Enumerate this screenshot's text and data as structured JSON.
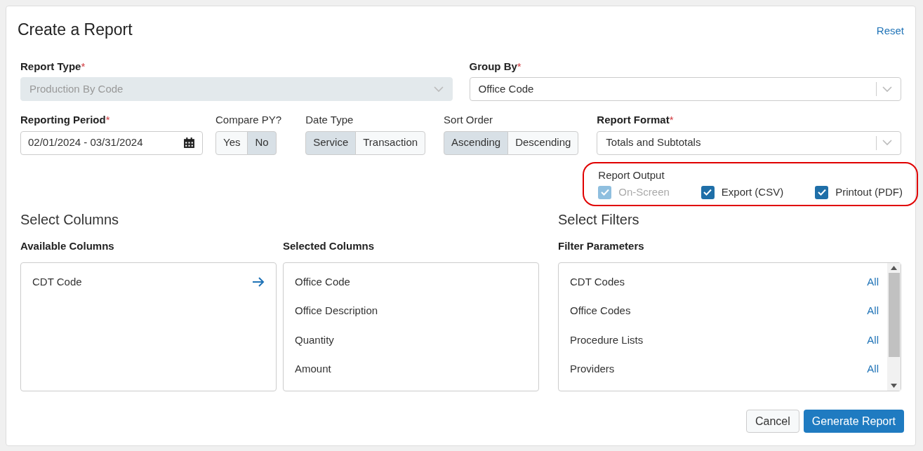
{
  "dialog": {
    "title": "Create a Report",
    "reset_link": "Reset"
  },
  "report_type": {
    "label": "Report Type",
    "required": "*",
    "value": "Production By Code",
    "disabled": true
  },
  "group_by": {
    "label": "Group By",
    "required": "*",
    "value": "Office Code",
    "disabled": false
  },
  "reporting_period": {
    "label": "Reporting Period",
    "required": "*",
    "value": "02/01/2024 - 03/31/2024"
  },
  "compare_py": {
    "label": "Compare PY?",
    "options": [
      {
        "label": "Yes",
        "selected": false
      },
      {
        "label": "No",
        "selected": true
      }
    ]
  },
  "date_type": {
    "label": "Date Type",
    "options": [
      {
        "label": "Service",
        "selected": true
      },
      {
        "label": "Transaction",
        "selected": false
      }
    ]
  },
  "sort_order": {
    "label": "Sort Order",
    "options": [
      {
        "label": "Ascending",
        "selected": true
      },
      {
        "label": "Descending",
        "selected": false
      }
    ]
  },
  "report_format": {
    "label": "Report Format",
    "required": "*",
    "value": "Totals and Subtotals",
    "disabled": false
  },
  "report_output": {
    "label": "Report Output",
    "highlighted": true,
    "options": [
      {
        "label": "On-Screen",
        "checked": true,
        "disabled": true
      },
      {
        "label": "Export (CSV)",
        "checked": true,
        "disabled": false
      },
      {
        "label": "Printout (PDF)",
        "checked": true,
        "disabled": false
      }
    ]
  },
  "select_columns": {
    "title": "Select Columns",
    "available": {
      "label": "Available Columns",
      "items": [
        "CDT Code"
      ]
    },
    "selected": {
      "label": "Selected Columns",
      "items": [
        "Office Code",
        "Office Description",
        "Quantity",
        "Amount"
      ]
    }
  },
  "select_filters": {
    "title": "Select Filters",
    "label": "Filter Parameters",
    "items": [
      {
        "name": "CDT Codes",
        "value": "All"
      },
      {
        "name": "Office Codes",
        "value": "All"
      },
      {
        "name": "Procedure Lists",
        "value": "All"
      },
      {
        "name": "Providers",
        "value": "All"
      }
    ]
  },
  "buttons": [
    {
      "label": "Cancel",
      "kind": "secondary"
    },
    {
      "label": "Generate Report",
      "kind": "primary"
    }
  ]
}
